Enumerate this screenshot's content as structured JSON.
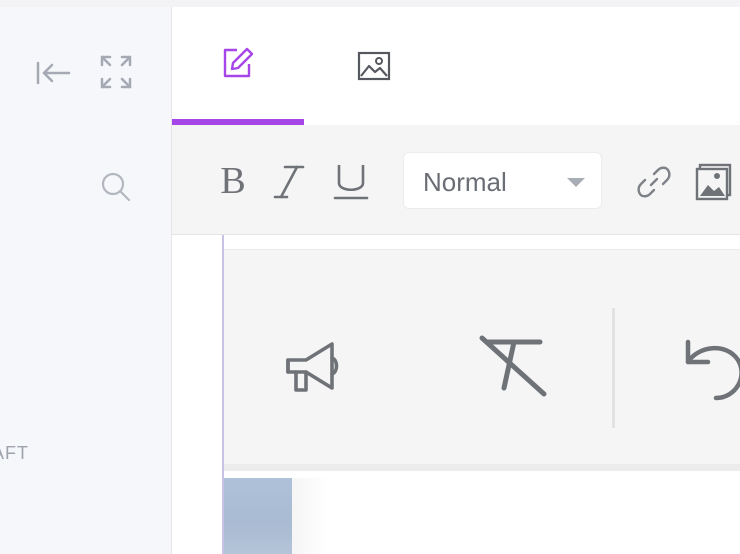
{
  "left_panel": {
    "status_text": "AFT",
    "icons": {
      "menu": "menu-icon",
      "collapse": "collapse-left-icon",
      "expand": "fullscreen-icon",
      "search": "search-icon"
    }
  },
  "editor": {
    "tabs": [
      {
        "name": "edit",
        "icon": "pencil-square-icon",
        "active": true
      },
      {
        "name": "image",
        "icon": "image-icon",
        "active": false
      }
    ],
    "accent_color": "#a646e8",
    "toolbar": {
      "bold_label": "B",
      "format_select_value": "Normal"
    },
    "popover_icons": [
      "megaphone-icon",
      "clear-format-icon",
      "undo-icon"
    ]
  }
}
